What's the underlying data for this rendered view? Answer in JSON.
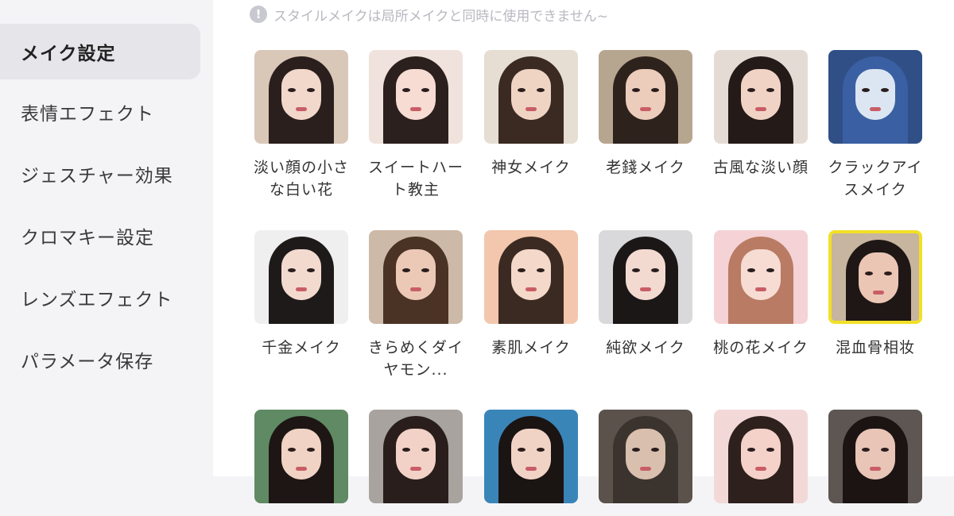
{
  "sidebar": {
    "items": [
      {
        "label": "メイク設定",
        "active": true
      },
      {
        "label": "表情エフェクト",
        "active": false
      },
      {
        "label": "ジェスチャー効果",
        "active": false
      },
      {
        "label": "クロマキー設定",
        "active": false
      },
      {
        "label": "レンズエフェクト",
        "active": false
      },
      {
        "label": "パラメータ保存",
        "active": false
      }
    ]
  },
  "notice": {
    "icon": "info-icon",
    "text": "スタイルメイクは局所メイクと同時に使用できません~"
  },
  "styles": [
    {
      "label": "淡い顔の小さな白い花",
      "bg": "#d9c7b8",
      "hair": "#2a1f1c",
      "skin": "#f2d7cb"
    },
    {
      "label": "スイートハート教主",
      "bg": "#f0e2dc",
      "hair": "#2b201e",
      "skin": "#f6dcd3"
    },
    {
      "label": "神女メイク",
      "bg": "#e6ddd3",
      "hair": "#3a2a22",
      "skin": "#efd4c4"
    },
    {
      "label": "老錢メイク",
      "bg": "#b7a68f",
      "hair": "#2e221d",
      "skin": "#ecccbb"
    },
    {
      "label": "古風な淡い顔",
      "bg": "#e5dbd5",
      "hair": "#241a18",
      "skin": "#f1d3c6"
    },
    {
      "label": "クラックアイスメイク",
      "bg": "#2f4f86",
      "hair": "#3a5fa3",
      "skin": "#dce6f2"
    },
    {
      "label": "千金メイク",
      "bg": "#efefef",
      "hair": "#1f1a1a",
      "skin": "#f3dacf"
    },
    {
      "label": "きらめくダイヤモン...",
      "bg": "#cdb9a8",
      "hair": "#4a3224",
      "skin": "#ecc9b6"
    },
    {
      "label": "素肌メイク",
      "bg": "#f2c7ad",
      "hair": "#3b2a22",
      "skin": "#f4d8c9"
    },
    {
      "label": "純欲メイク",
      "bg": "#d9d9dc",
      "hair": "#1c1717",
      "skin": "#f3dad1"
    },
    {
      "label": "桃の花メイク",
      "bg": "#f4d2d5",
      "hair": "#b97b63",
      "skin": "#f7dcd3"
    },
    {
      "label": "混血骨相妆",
      "bg": "#c7b59f",
      "hair": "#1e1715",
      "skin": "#ecc6b5",
      "selected": true
    },
    {
      "label": "",
      "bg": "#5f8a64",
      "hair": "#1d1614",
      "skin": "#f0d3c4"
    },
    {
      "label": "",
      "bg": "#a9a3a0",
      "hair": "#2a1e1c",
      "skin": "#f2d2c7"
    },
    {
      "label": "",
      "bg": "#3a85b8",
      "hair": "#1a1413",
      "skin": "#f1d3c6"
    },
    {
      "label": "",
      "bg": "#5b524b",
      "hair": "#3b332e",
      "skin": "#d9bfae"
    },
    {
      "label": "",
      "bg": "#f2d9d7",
      "hair": "#2e201d",
      "skin": "#f4d2c9"
    },
    {
      "label": "",
      "bg": "#5d5653",
      "hair": "#1b1413",
      "skin": "#e8c5b6"
    }
  ]
}
